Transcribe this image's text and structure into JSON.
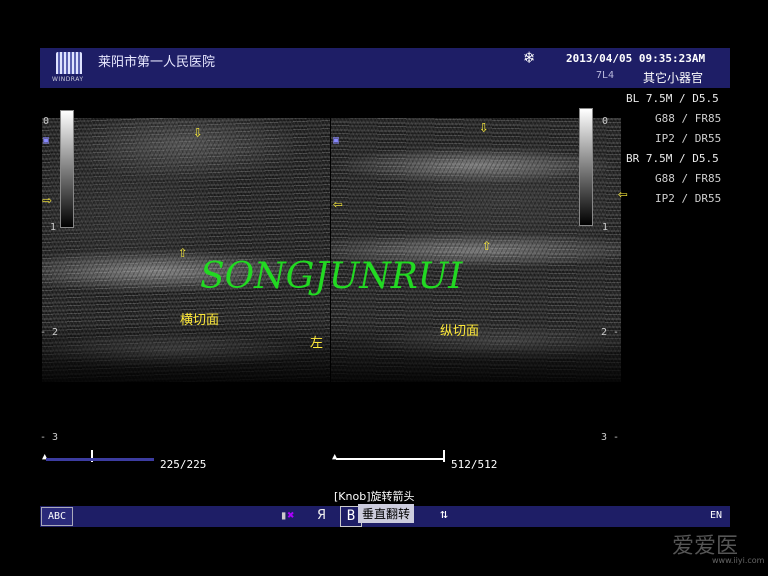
{
  "header": {
    "brand": "WINDRAY",
    "hospital": "莱阳市第一人民医院",
    "freeze_icon": "snowflake-icon",
    "datetime": "2013/04/05  09:35:23AM",
    "probe": "7L4",
    "preset": "其它小器官"
  },
  "params": {
    "bl_label": "BL",
    "bl_freq": "7.5M / D5.5",
    "bl_g": "G88 / FR85",
    "bl_ip": "IP2 / DR55",
    "br_label": "BR",
    "br_freq": "7.5M / D5.5",
    "br_g": "G88 / FR85",
    "br_ip": "IP2 / DR55"
  },
  "depth": {
    "left": [
      "-",
      "0",
      "1",
      "- 2",
      "- 3"
    ],
    "right": [
      "0",
      "1",
      "2 -",
      "3 -"
    ]
  },
  "images": {
    "left_label": "横切面",
    "left_side": "左",
    "right_label": "纵切面",
    "watermark": "SONGJUNRUI"
  },
  "scales": {
    "left": "225/225",
    "right": "512/512"
  },
  "bottom": {
    "knob_hint": "[Knob]旋转箭头",
    "abc": "ABC",
    "mirror_glyph": "Я",
    "vflip_icon": "B",
    "vflip_tooltip": "垂直翻转",
    "updown_arrows": "⇅",
    "lang": "EN"
  },
  "site": {
    "mark": "爱爱医",
    "url": "www.iiyi.com"
  },
  "colors": {
    "header_bg": "#1e1e66",
    "arrow_yellow": "#ffef3a",
    "watermark_green": "#22d922"
  }
}
